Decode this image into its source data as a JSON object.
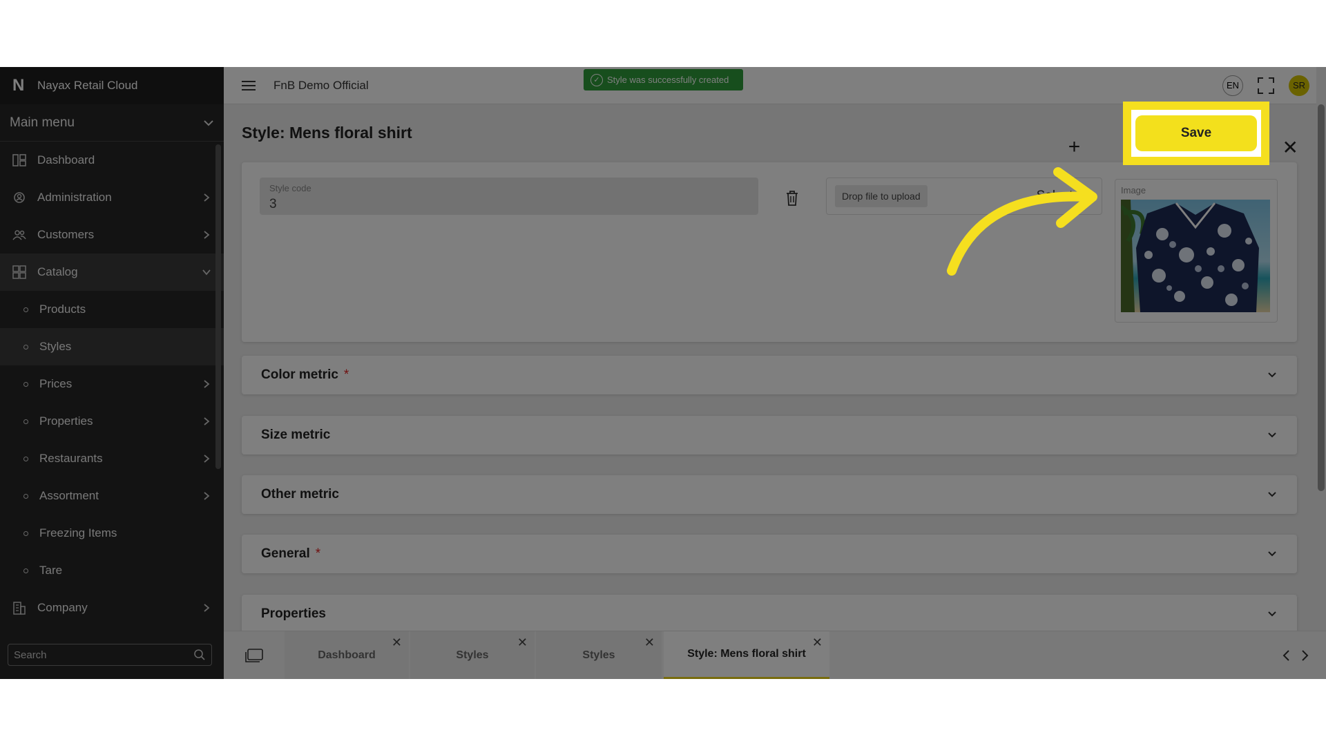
{
  "brand": {
    "logo": "N",
    "name": "Nayax Retail Cloud"
  },
  "sidebar": {
    "main_menu": "Main menu",
    "items": [
      {
        "label": "Dashboard",
        "icon": "dashboard-icon"
      },
      {
        "label": "Administration",
        "icon": "gear-user-icon"
      },
      {
        "label": "Customers",
        "icon": "users-icon"
      },
      {
        "label": "Catalog",
        "icon": "grid-icon"
      }
    ],
    "sub_items": [
      {
        "label": "Products"
      },
      {
        "label": "Styles"
      },
      {
        "label": "Prices"
      },
      {
        "label": "Properties"
      },
      {
        "label": "Restaurants"
      },
      {
        "label": "Assortment"
      },
      {
        "label": "Freezing Items"
      },
      {
        "label": "Tare"
      }
    ],
    "company": {
      "label": "Company",
      "icon": "building-icon"
    },
    "search_placeholder": "Search"
  },
  "topbar": {
    "company": "FnB Demo Official",
    "toast": "Style was successfully created",
    "lang": "EN",
    "avatar": "SR"
  },
  "page": {
    "title": "Style: Mens floral shirt",
    "save": "Save",
    "style_code_label": "Style code",
    "style_code_value": "3",
    "drop_label": "Drop file to upload",
    "select_file": "Select file",
    "image_label": "Image"
  },
  "sections": [
    {
      "label": "Color metric",
      "required": "*"
    },
    {
      "label": "Size metric",
      "required": ""
    },
    {
      "label": "Other metric",
      "required": ""
    },
    {
      "label": "General",
      "required": "*"
    },
    {
      "label": "Properties",
      "required": ""
    }
  ],
  "tabs": [
    {
      "label": "Dashboard"
    },
    {
      "label": "Styles"
    },
    {
      "label": "Styles"
    },
    {
      "label": "Style: Mens floral shirt"
    }
  ],
  "colors": {
    "accent": "#f5df1f",
    "toast": "#2e9c3a",
    "sidebar": "#262626"
  }
}
